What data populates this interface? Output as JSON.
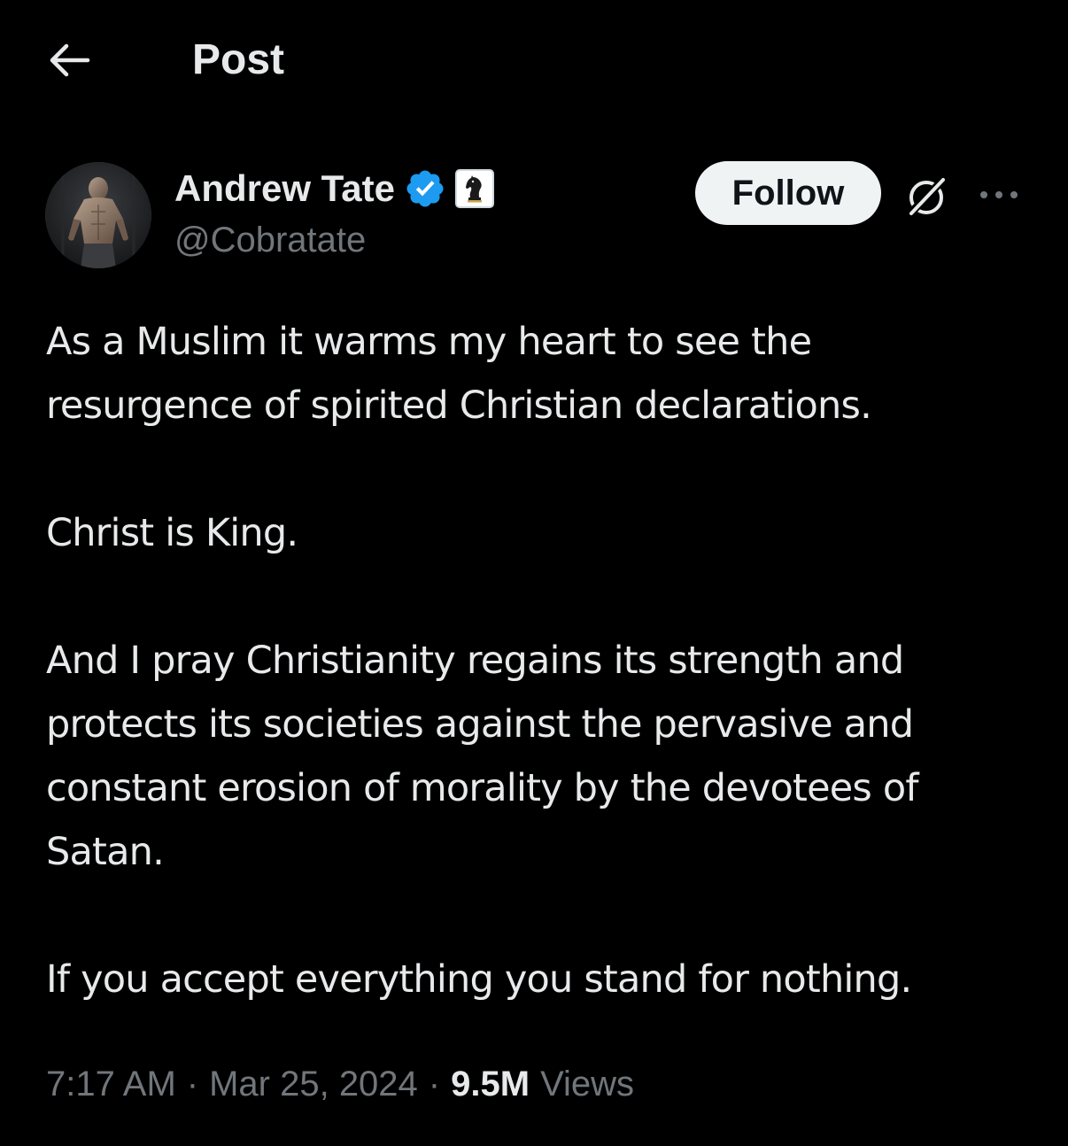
{
  "header": {
    "title": "Post",
    "back_icon": "arrow-left-icon"
  },
  "author": {
    "name": "Andrew Tate",
    "handle": "@Cobratate",
    "verified_icon": "verified-badge-icon",
    "verified_color": "#1d9bf0",
    "affiliate_icon": "chess-knight-icon",
    "avatar": "profile-photo"
  },
  "actions": {
    "follow_label": "Follow",
    "grok_icon": "grok-icon",
    "more_icon": "more-horizontal-icon"
  },
  "post": {
    "paragraphs": [
      [
        "As a Muslim it warms my heart to see the",
        "resurgence of spirited Christian declarations."
      ],
      [
        "Christ is King."
      ],
      [
        "And I pray Christianity regains its strength and",
        "protects its societies against the pervasive and",
        "constant erosion of morality by the devotees of",
        "Satan."
      ],
      [
        "If you accept everything you stand for nothing."
      ]
    ]
  },
  "meta": {
    "time": "7:17 AM",
    "separator": "·",
    "date": "Mar 25, 2024",
    "views_count": "9.5M",
    "views_label": "Views"
  },
  "colors": {
    "background": "#000000",
    "primary_text": "#e7e9ea",
    "secondary_text": "#71767b",
    "follow_bg": "#eff3f4",
    "follow_text": "#0f1419"
  }
}
